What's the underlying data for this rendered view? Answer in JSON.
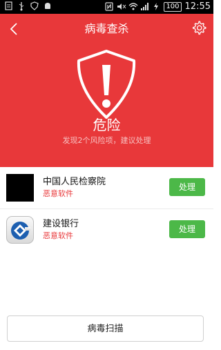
{
  "status_bar": {
    "time": "12:55",
    "battery": "100",
    "icons": [
      "notification-icon",
      "usb-icon",
      "shield-status-icon",
      "android-icon",
      "nfc-icon",
      "mute-icon",
      "wifi-icon",
      "signal-icon",
      "charging-icon"
    ]
  },
  "header": {
    "title": "病毒查杀",
    "status": "危险",
    "subtitle": "发现2个风险项，建议处理",
    "background": "#e8383a"
  },
  "risks": [
    {
      "name": "中国人民检察院",
      "tag": "恶意软件",
      "action": "处理",
      "icon": "black-square-app-icon"
    },
    {
      "name": "建设银行",
      "tag": "恶意软件",
      "action": "处理",
      "icon": "ccb-app-icon"
    }
  ],
  "scan_button": "病毒扫描",
  "colors": {
    "danger": "#e8383a",
    "action": "#4cb848"
  }
}
